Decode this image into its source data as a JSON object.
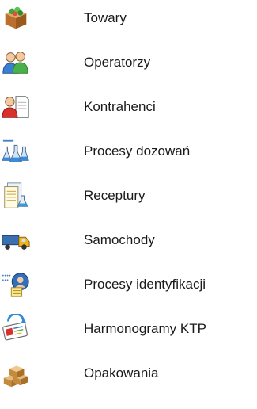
{
  "menu": {
    "items": [
      {
        "label": "Towary",
        "icon": "goods-box-icon"
      },
      {
        "label": "Operatorzy",
        "icon": "operators-icon"
      },
      {
        "label": "Kontrahenci",
        "icon": "contractors-icon"
      },
      {
        "label": "Procesy dozowań",
        "icon": "dosing-flasks-icon"
      },
      {
        "label": "Receptury",
        "icon": "recipes-icon"
      },
      {
        "label": "Samochody",
        "icon": "truck-icon"
      },
      {
        "label": "Procesy identyfikacji",
        "icon": "identification-icon"
      },
      {
        "label": "Harmonogramy KTP",
        "icon": "schedule-card-icon"
      },
      {
        "label": "Opakowania",
        "icon": "packaging-boxes-icon"
      }
    ]
  }
}
